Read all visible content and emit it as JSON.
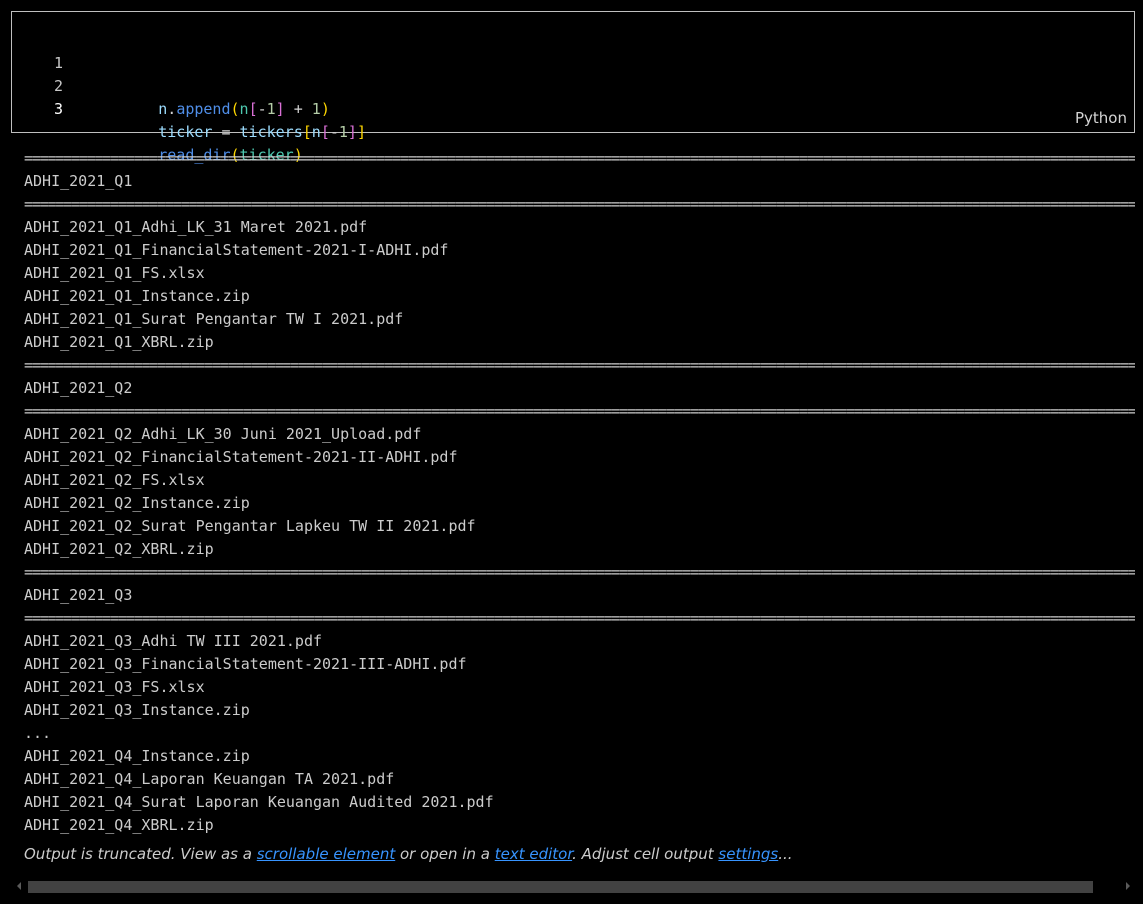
{
  "code_cell": {
    "language": "Python",
    "line_numbers": [
      "1",
      "2",
      "3"
    ],
    "lines": [
      [
        "n",
        ".",
        "append",
        "(",
        "n",
        "[",
        "-",
        "1",
        "]",
        " + ",
        "1",
        ")"
      ],
      [
        "ticker",
        " = ",
        "tickers",
        "[",
        "n",
        "[",
        "-",
        "1",
        "]",
        "]"
      ],
      [
        "read_dir",
        "(",
        "ticker",
        ")"
      ]
    ]
  },
  "output": {
    "separator": "==========================================================================================================================================================",
    "lines": [
      {
        "kind": "sep"
      },
      {
        "kind": "text",
        "text": "ADHI_2021_Q1"
      },
      {
        "kind": "sep"
      },
      {
        "kind": "text",
        "text": "ADHI_2021_Q1_Adhi_LK_31 Maret 2021.pdf"
      },
      {
        "kind": "text",
        "text": "ADHI_2021_Q1_FinancialStatement-2021-I-ADHI.pdf"
      },
      {
        "kind": "text",
        "text": "ADHI_2021_Q1_FS.xlsx"
      },
      {
        "kind": "text",
        "text": "ADHI_2021_Q1_Instance.zip"
      },
      {
        "kind": "text",
        "text": "ADHI_2021_Q1_Surat Pengantar TW I 2021.pdf"
      },
      {
        "kind": "text",
        "text": "ADHI_2021_Q1_XBRL.zip"
      },
      {
        "kind": "sep"
      },
      {
        "kind": "text",
        "text": "ADHI_2021_Q2"
      },
      {
        "kind": "sep"
      },
      {
        "kind": "text",
        "text": "ADHI_2021_Q2_Adhi_LK_30 Juni 2021_Upload.pdf"
      },
      {
        "kind": "text",
        "text": "ADHI_2021_Q2_FinancialStatement-2021-II-ADHI.pdf"
      },
      {
        "kind": "text",
        "text": "ADHI_2021_Q2_FS.xlsx"
      },
      {
        "kind": "text",
        "text": "ADHI_2021_Q2_Instance.zip"
      },
      {
        "kind": "text",
        "text": "ADHI_2021_Q2_Surat Pengantar Lapkeu TW II 2021.pdf"
      },
      {
        "kind": "text",
        "text": "ADHI_2021_Q2_XBRL.zip"
      },
      {
        "kind": "sep"
      },
      {
        "kind": "text",
        "text": "ADHI_2021_Q3"
      },
      {
        "kind": "sep"
      },
      {
        "kind": "text",
        "text": "ADHI_2021_Q3_Adhi TW III 2021.pdf"
      },
      {
        "kind": "text",
        "text": "ADHI_2021_Q3_FinancialStatement-2021-III-ADHI.pdf"
      },
      {
        "kind": "text",
        "text": "ADHI_2021_Q3_FS.xlsx"
      },
      {
        "kind": "text",
        "text": "ADHI_2021_Q3_Instance.zip"
      },
      {
        "kind": "text",
        "text": "..."
      },
      {
        "kind": "text",
        "text": "ADHI_2021_Q4_Instance.zip"
      },
      {
        "kind": "text",
        "text": "ADHI_2021_Q4_Laporan Keuangan TA 2021.pdf"
      },
      {
        "kind": "text",
        "text": "ADHI_2021_Q4_Surat Laporan Keuangan Audited 2021.pdf"
      },
      {
        "kind": "text",
        "text": "ADHI_2021_Q4_XBRL.zip"
      }
    ]
  },
  "truncation_notice": {
    "prefix": "Output is truncated. View as a ",
    "link_scrollable": "scrollable element",
    "middle": " or open in a ",
    "link_editor": "text editor",
    "middle2": ". Adjust cell output ",
    "link_settings": "settings",
    "suffix": "..."
  },
  "colors": {
    "background": "#000000",
    "link": "#3794ff",
    "text": "#cccccc"
  }
}
